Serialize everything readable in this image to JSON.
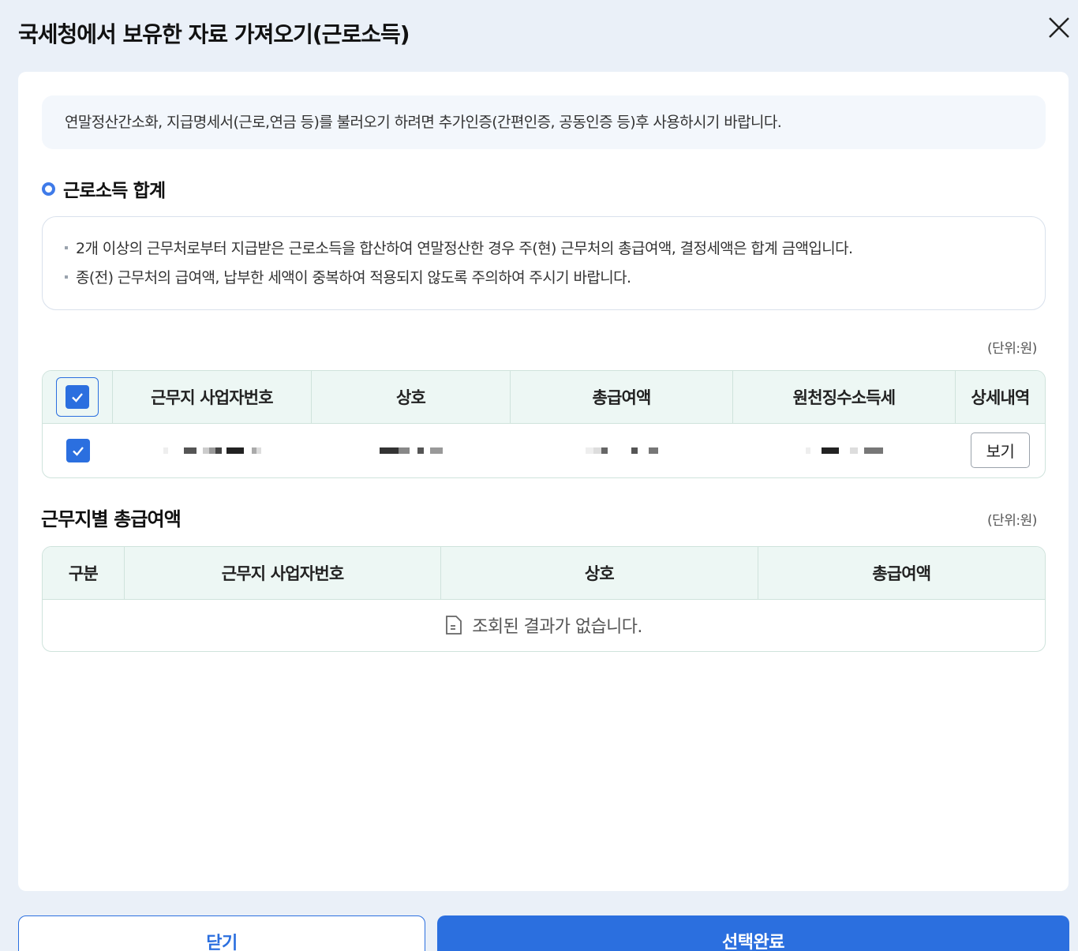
{
  "dialog": {
    "title": "국세청에서 보유한 자료 가져오기(근로소득)",
    "close_icon": "close-icon"
  },
  "notice": "연말정산간소화, 지급명세서(근로,연금 등)를 불러오기 하려면 추가인증(간편인증, 공동인증 등)후 사용하시기 바랍니다.",
  "income_total": {
    "title": "근로소득 합계",
    "info": [
      "2개 이상의 근무처로부터 지급받은 근로소득을 합산하여 연말정산한 경우 주(현) 근무처의 총급여액, 결정세액은 합계 금액입니다.",
      "종(전) 근무처의 급여액, 납부한 세액이 중복하여 적용되지 않도록 주의하여 주시기 바랍니다."
    ],
    "unit": "(단위:원)",
    "columns": [
      "근무지 사업자번호",
      "상호",
      "총급여액",
      "원천징수소득세",
      "상세내역"
    ],
    "header_checked": true,
    "rows": [
      {
        "checked": true,
        "view_label": "보기"
      }
    ]
  },
  "by_workplace": {
    "title": "근무지별 총급여액",
    "unit": "(단위:원)",
    "columns": [
      "구분",
      "근무지 사업자번호",
      "상호",
      "총급여액"
    ],
    "empty_message": "조회된 결과가 없습니다.",
    "empty_icon": "document-icon"
  },
  "footer": {
    "close_label": "닫기",
    "confirm_label": "선택완료"
  },
  "colors": {
    "accent": "#2b6fdf",
    "table_header_bg": "#edf7f4",
    "page_bg": "#eaf0f8"
  }
}
